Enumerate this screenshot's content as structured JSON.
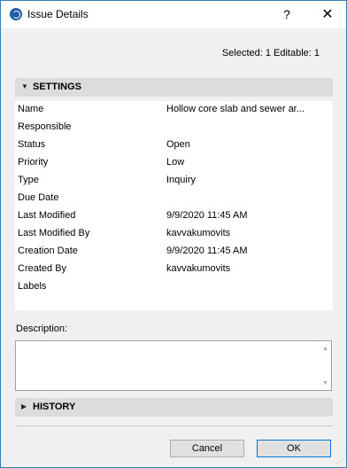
{
  "window": {
    "title": "Issue Details",
    "help_label": "?",
    "close_label": "✕"
  },
  "selection_info": "Selected: 1 Editable: 1",
  "settings": {
    "header": "SETTINGS",
    "properties": [
      {
        "name": "Name",
        "value": "Hollow core slab and sewer ar..."
      },
      {
        "name": "Responsible",
        "value": ""
      },
      {
        "name": "Status",
        "value": "Open"
      },
      {
        "name": "Priority",
        "value": "Low"
      },
      {
        "name": "Type",
        "value": "Inquiry"
      },
      {
        "name": "Due Date",
        "value": ""
      },
      {
        "name": "Last Modified",
        "value": "9/9/2020 11:45 AM"
      },
      {
        "name": "Last Modified By",
        "value": "kavvakumovits"
      },
      {
        "name": "Creation Date",
        "value": "9/9/2020 11:45 AM"
      },
      {
        "name": "Created By",
        "value": "kavvakumovits"
      },
      {
        "name": "Labels",
        "value": ""
      }
    ]
  },
  "description": {
    "label": "Description:",
    "value": ""
  },
  "history": {
    "header": "HISTORY"
  },
  "buttons": {
    "cancel": "Cancel",
    "ok": "OK"
  },
  "icons": {
    "app": "archicad-logo-icon",
    "settings_chevron": "chevron-down-icon",
    "history_chevron": "chevron-right-icon"
  }
}
